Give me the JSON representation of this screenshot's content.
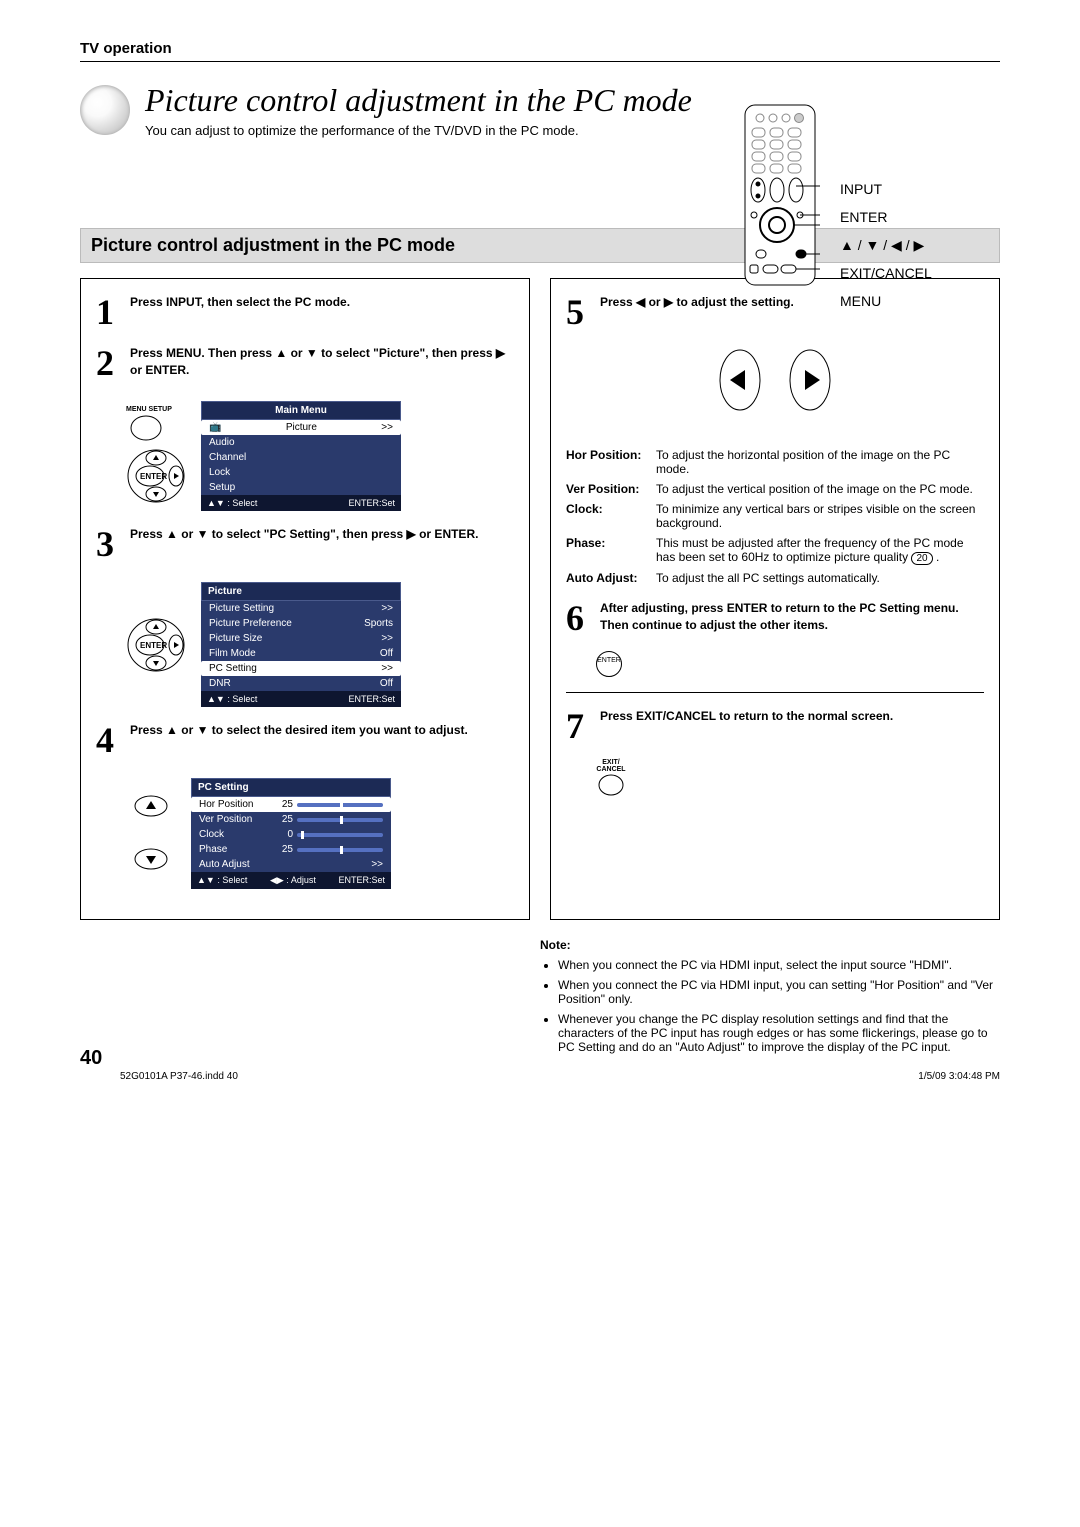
{
  "header": "TV operation",
  "title": "Picture control adjustment in the PC mode",
  "subtitle": "You can adjust to optimize the performance of the TV/DVD in the PC mode.",
  "remote_labels": {
    "input": "INPUT",
    "enter": "ENTER",
    "arrows": "▲ / ▼ / ◀ / ▶",
    "exit": "EXIT/CANCEL",
    "menu": "MENU"
  },
  "section_heading": "Picture control adjustment in the PC mode",
  "steps": {
    "s1": "Press INPUT, then select the PC mode.",
    "s2": "Press MENU. Then press ▲ or ▼ to select \"Picture\", then press ▶ or ENTER.",
    "s3": "Press ▲ or ▼ to select \"PC Setting\", then press ▶ or ENTER.",
    "s4": "Press ▲ or ▼ to select the desired item you want to adjust.",
    "s5": "Press ◀ or ▶ to adjust the setting.",
    "s6": "After adjusting, press ENTER to return to the PC Setting menu. Then continue to adjust the other items.",
    "s7": "Press EXIT/CANCEL to return to the normal screen."
  },
  "labels": {
    "menu_setup": "MENU SETUP",
    "enter": "ENTER",
    "exit_cancel": "EXIT/ CANCEL"
  },
  "main_menu": {
    "title": "Main Menu",
    "items": [
      "Picture",
      "Audio",
      "Channel",
      "Lock",
      "Setup"
    ],
    "select_more": ">>",
    "foot_select": "▲▼ : Select",
    "foot_set": "ENTER:Set"
  },
  "picture_menu": {
    "title": "Picture",
    "rows": [
      {
        "l": "Picture Setting",
        "v": ">>"
      },
      {
        "l": "Picture Preference",
        "v": "Sports"
      },
      {
        "l": "Picture Size",
        "v": ">>"
      },
      {
        "l": "Film Mode",
        "v": "Off"
      },
      {
        "l": "PC Setting",
        "v": ">>"
      },
      {
        "l": "DNR",
        "v": "Off"
      }
    ],
    "foot_select": "▲▼ : Select",
    "foot_set": "ENTER:Set"
  },
  "pc_setting": {
    "title": "PC Setting",
    "rows": [
      {
        "l": "Hor Position",
        "v": "25",
        "pos": 50
      },
      {
        "l": "Ver Position",
        "v": "25",
        "pos": 50
      },
      {
        "l": "Clock",
        "v": "0",
        "pos": 10
      },
      {
        "l": "Phase",
        "v": "25",
        "pos": 50
      },
      {
        "l": "Auto Adjust",
        "v": ">>",
        "pos": null
      }
    ],
    "foot_select": "▲▼ : Select",
    "foot_adjust": "◀▶ : Adjust",
    "foot_set": "ENTER:Set"
  },
  "defs": {
    "hor_l": "Hor Position:",
    "hor_t": "To adjust the horizontal position of the image on the PC mode.",
    "ver_l": "Ver  Position:",
    "ver_t": "To adjust the vertical position of the image on the PC mode.",
    "clk_l": "Clock:",
    "clk_t": "To minimize any vertical bars or stripes visible on the screen background.",
    "ph_l": "Phase:",
    "ph_t1": "This must be adjusted after the frequency of the PC mode has been set to 60Hz to optimize picture quality ",
    "ph_page": "20",
    "aa_l": "Auto Adjust:",
    "aa_t": "To adjust the all PC settings automatically."
  },
  "notes": {
    "hdr": "Note:",
    "b1": "When you connect the PC via HDMI input, select the input source \"HDMI\".",
    "b2": "When you connect the PC via HDMI input, you can setting \"Hor Position\" and \"Ver Position\" only.",
    "b3": "Whenever you change the PC display resolution settings and find that the characters of the PC input has rough edges or has some flickerings, please go to PC Setting and do an \"Auto Adjust\" to improve the display of the PC input."
  },
  "page_number": "40",
  "footer_left": "52G0101A P37-46.indd   40",
  "footer_right": "1/5/09   3:04:48 PM"
}
